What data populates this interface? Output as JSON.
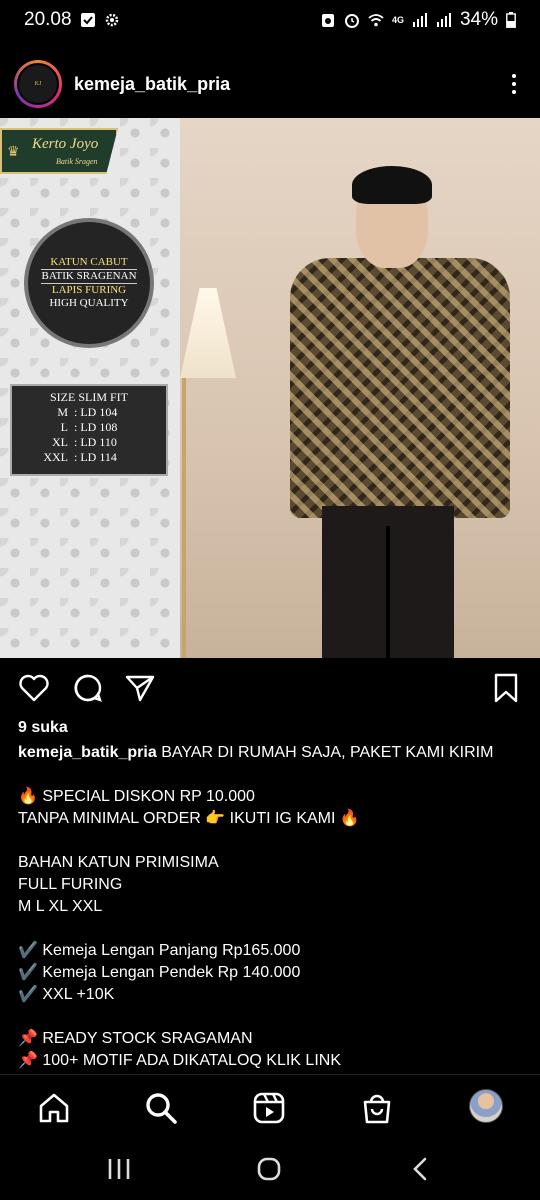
{
  "status_bar": {
    "time": "20.08",
    "network": "4G",
    "battery": "34%"
  },
  "post": {
    "username": "kemeja_batik_pria",
    "image": {
      "brand_name": "Kerto Joyo",
      "brand_sub": "Batik Sragen",
      "features": [
        "KATUN CABUT",
        "BATIK SRAGENAN",
        "LAPIS FURING",
        "HIGH QUALITY"
      ],
      "size_title": "SIZE SLIM FIT",
      "sizes": [
        {
          "size": "M",
          "ld": ": LD 104"
        },
        {
          "size": "L",
          "ld": ": LD 108"
        },
        {
          "size": "XL",
          "ld": ": LD 110"
        },
        {
          "size": "XXL",
          "ld": ": LD 114"
        }
      ]
    },
    "likes": "9 suka",
    "caption_username": "kemeja_batik_pria",
    "caption_text": " BAYAR DI RUMAH SAJA, PAKET KAMI KIRIM\n\n🔥 SPECIAL DISKON RP 10.000\nTANPA MINIMAL ORDER 👉 IKUTI IG KAMI 🔥\n\nBAHAN KATUN PRIMISIMA\nFULL FURING\nM L XL XXL\n\n✔️ Kemeja Lengan Panjang Rp165.000\n✔️ Kemeja Lengan Pendek Rp 140.000\n✔️ XXL +10K\n\n📌 READY STOCK SRAGAMAN\n📌 100+ MOTIF ADA DIKATALOQ KLIK LINK"
  },
  "icons": {
    "actions": [
      "heart-icon",
      "comment-icon",
      "share-icon",
      "bookmark-icon"
    ],
    "nav": [
      "home-icon",
      "search-icon",
      "reels-icon",
      "shop-icon",
      "profile-avatar"
    ],
    "system": [
      "recents-icon",
      "home-circle-icon",
      "back-icon"
    ]
  },
  "colors": {
    "background": "#000000",
    "text": "#ffffff"
  }
}
